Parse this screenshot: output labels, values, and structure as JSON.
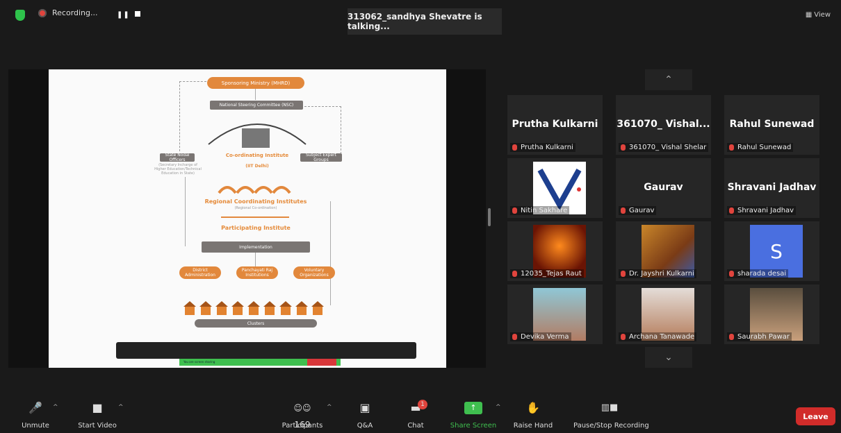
{
  "topbar": {
    "recording_label": "Recording...",
    "pause_icon": "❚❚",
    "talking": "313062_sandhya Shevatre is talking...",
    "view_label": "View",
    "view_icon": "▦"
  },
  "slide": {
    "sponsoring": "Sponsoring Ministry (MHRD)",
    "nsc": "National Steering Committee (NSC)",
    "state_officers": "State Nodal Officers",
    "state_sub": "(Secretary Incharge of Higher Education/Technical Education in State)",
    "coordinating": "Co-ordinating Institute",
    "iit": "(IIT Delhi)",
    "expert": "Subject Expert Groups",
    "regional": "Regional Coordinating Institutes",
    "regional_sub": "(Regional Co-ordination)",
    "participating": "Participating Institute",
    "implementation": "Implementation",
    "district": "District Administration",
    "panchayat": "Panchayati Raj Institutions",
    "voluntary": "Voluntary Organizations",
    "clusters": "Clusters",
    "sharing_text": "You are screen sharing"
  },
  "gallery": {
    "up_icon": "⌃",
    "down_icon": "⌄",
    "tiles": [
      {
        "big": "Prutha Kulkarni",
        "label": "Prutha Kulkarni"
      },
      {
        "big": "361070_ Vishal...",
        "label": "361070_ Vishal Shelar"
      },
      {
        "big": "Rahul Sunewad",
        "label": "Rahul Sunewad"
      },
      {
        "big": "",
        "label": "Nitin Sakhare"
      },
      {
        "big": "Gaurav",
        "label": "Gaurav"
      },
      {
        "big": "Shravani Jadhav",
        "label": "Shravani Jadhav"
      },
      {
        "big": "",
        "label": "12035_Tejas Raut"
      },
      {
        "big": "",
        "label": "Dr. Jayshri Kulkarni"
      },
      {
        "big": "",
        "label": "sharada desai",
        "avatar_letter": "S"
      },
      {
        "big": "",
        "label": "Devika Verma"
      },
      {
        "big": "",
        "label": "Archana Tanawade"
      },
      {
        "big": "",
        "label": "Saurabh Pawar"
      }
    ]
  },
  "toolbar": {
    "unmute": "Unmute",
    "start_video": "Start Video",
    "participants": "Participants",
    "participants_count": "169",
    "qa": "Q&A",
    "chat": "Chat",
    "chat_badge": "1",
    "share_screen": "Share Screen",
    "raise_hand": "Raise Hand",
    "pause_stop": "Pause/Stop Recording",
    "leave": "Leave"
  },
  "colors": {
    "accent_orange": "#e2883c",
    "share_green": "#3fbf4f",
    "leave_red": "#d12c2a",
    "avatar_blue": "#4a6fe0"
  }
}
